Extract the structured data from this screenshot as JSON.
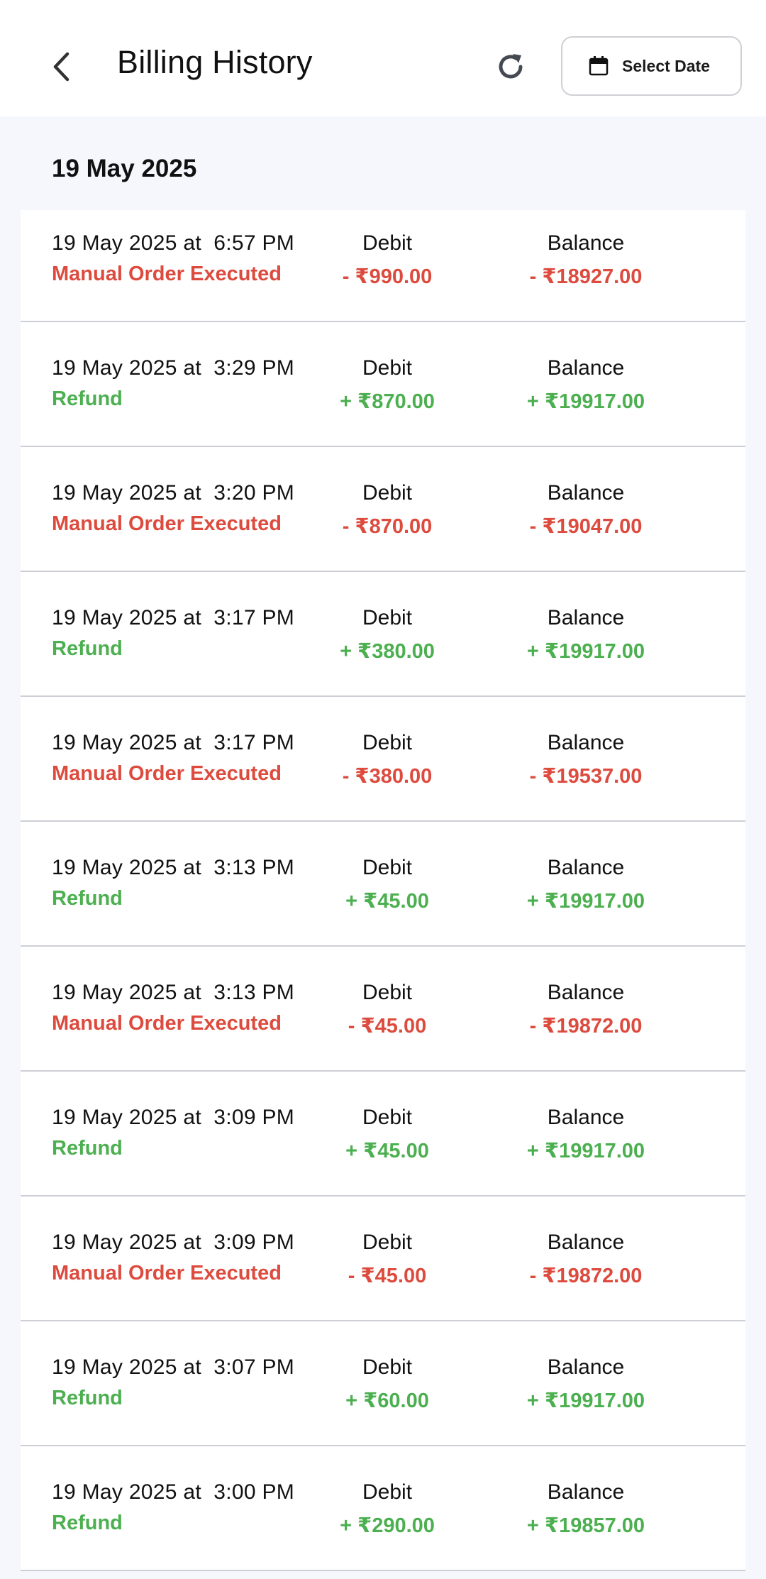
{
  "header": {
    "title": "Billing History",
    "back_icon": "chevron-left-icon",
    "refresh_icon": "refresh-icon",
    "date_button_label": "Select Date",
    "date_button_icon": "calendar-icon"
  },
  "section": {
    "title": "19 May 2025"
  },
  "labels": {
    "debit": "Debit",
    "balance": "Balance"
  },
  "colors": {
    "negative": "#dd4b3e",
    "positive": "#4caf50",
    "background": "#f6f7fc"
  },
  "transactions": [
    {
      "datetime": "19 May 2025 at  6:57 PM",
      "type": "Manual Order Executed",
      "debit": "- ₹990.00",
      "balance": "- ₹18927.00",
      "sign": "neg"
    },
    {
      "datetime": "19 May 2025 at  3:29 PM",
      "type": "Refund",
      "debit": "+ ₹870.00",
      "balance": "+ ₹19917.00",
      "sign": "pos"
    },
    {
      "datetime": "19 May 2025 at  3:20 PM",
      "type": "Manual Order Executed",
      "debit": "- ₹870.00",
      "balance": "- ₹19047.00",
      "sign": "neg"
    },
    {
      "datetime": "19 May 2025 at  3:17 PM",
      "type": "Refund",
      "debit": "+ ₹380.00",
      "balance": "+ ₹19917.00",
      "sign": "pos"
    },
    {
      "datetime": "19 May 2025 at  3:17 PM",
      "type": "Manual Order Executed",
      "debit": "- ₹380.00",
      "balance": "- ₹19537.00",
      "sign": "neg"
    },
    {
      "datetime": "19 May 2025 at  3:13 PM",
      "type": "Refund",
      "debit": "+ ₹45.00",
      "balance": "+ ₹19917.00",
      "sign": "pos"
    },
    {
      "datetime": "19 May 2025 at  3:13 PM",
      "type": "Manual Order Executed",
      "debit": "- ₹45.00",
      "balance": "- ₹19872.00",
      "sign": "neg"
    },
    {
      "datetime": "19 May 2025 at  3:09 PM",
      "type": "Refund",
      "debit": "+ ₹45.00",
      "balance": "+ ₹19917.00",
      "sign": "pos"
    },
    {
      "datetime": "19 May 2025 at  3:09 PM",
      "type": "Manual Order Executed",
      "debit": "- ₹45.00",
      "balance": "- ₹19872.00",
      "sign": "neg"
    },
    {
      "datetime": "19 May 2025 at  3:07 PM",
      "type": "Refund",
      "debit": "+ ₹60.00",
      "balance": "+ ₹19917.00",
      "sign": "pos"
    },
    {
      "datetime": "19 May 2025 at  3:00 PM",
      "type": "Refund",
      "debit": "+ ₹290.00",
      "balance": "+ ₹19857.00",
      "sign": "pos"
    }
  ]
}
